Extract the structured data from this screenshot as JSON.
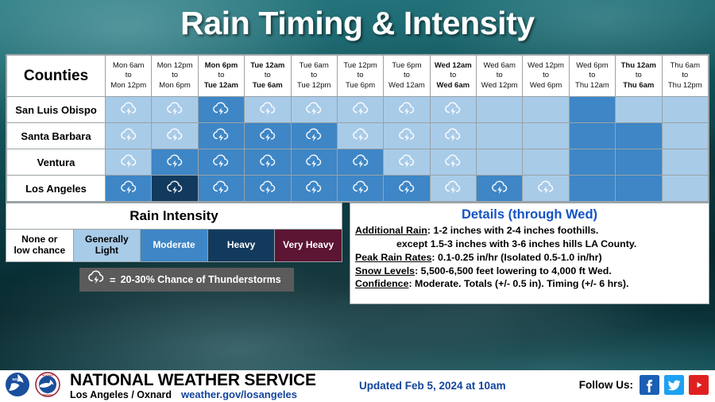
{
  "title": "Rain Timing & Intensity",
  "table": {
    "counties_header": "Counties",
    "periods": [
      {
        "l1": "Mon 6am",
        "l2": "to",
        "l3": "Mon 12pm",
        "bold_l1": false,
        "bold_l3": false
      },
      {
        "l1": "Mon 12pm",
        "l2": "to",
        "l3": "Mon 6pm",
        "bold_l1": false,
        "bold_l3": false
      },
      {
        "l1": "Mon 6pm",
        "l2": "to",
        "l3": "Tue 12am",
        "bold_l1": true,
        "bold_l3": true
      },
      {
        "l1": "Tue 12am",
        "l2": "to",
        "l3": "Tue 6am",
        "bold_l1": true,
        "bold_l3": true
      },
      {
        "l1": "Tue 6am",
        "l2": "to",
        "l3": "Tue 12pm",
        "bold_l1": false,
        "bold_l3": false
      },
      {
        "l1": "Tue 12pm",
        "l2": "to",
        "l3": "Tue 6pm",
        "bold_l1": false,
        "bold_l3": false
      },
      {
        "l1": "Tue 6pm",
        "l2": "to",
        "l3": "Wed 12am",
        "bold_l1": false,
        "bold_l3": false
      },
      {
        "l1": "Wed 12am",
        "l2": "to",
        "l3": "Wed 6am",
        "bold_l1": true,
        "bold_l3": true
      },
      {
        "l1": "Wed 6am",
        "l2": "to",
        "l3": "Wed 12pm",
        "bold_l1": false,
        "bold_l3": false
      },
      {
        "l1": "Wed 12pm",
        "l2": "to",
        "l3": "Wed 6pm",
        "bold_l1": false,
        "bold_l3": false
      },
      {
        "l1": "Wed 6pm",
        "l2": "to",
        "l3": "Thu 12am",
        "bold_l1": false,
        "bold_l3": false
      },
      {
        "l1": "Thu 12am",
        "l2": "to",
        "l3": "Thu 6am",
        "bold_l1": true,
        "bold_l3": true
      },
      {
        "l1": "Thu 6am",
        "l2": "to",
        "l3": "Thu 12pm",
        "bold_l1": false,
        "bold_l3": false
      }
    ],
    "rows": [
      {
        "county": "San Luis Obispo",
        "cells": [
          {
            "intensity": "light",
            "thunder": true
          },
          {
            "intensity": "light",
            "thunder": true
          },
          {
            "intensity": "mod",
            "thunder": true
          },
          {
            "intensity": "light",
            "thunder": true
          },
          {
            "intensity": "light",
            "thunder": true
          },
          {
            "intensity": "light",
            "thunder": true
          },
          {
            "intensity": "light",
            "thunder": true
          },
          {
            "intensity": "light",
            "thunder": true
          },
          {
            "intensity": "light",
            "thunder": false
          },
          {
            "intensity": "light",
            "thunder": false
          },
          {
            "intensity": "mod",
            "thunder": false
          },
          {
            "intensity": "light",
            "thunder": false
          },
          {
            "intensity": "light",
            "thunder": false
          }
        ]
      },
      {
        "county": "Santa Barbara",
        "cells": [
          {
            "intensity": "light",
            "thunder": true
          },
          {
            "intensity": "light",
            "thunder": true
          },
          {
            "intensity": "mod",
            "thunder": true
          },
          {
            "intensity": "mod",
            "thunder": true
          },
          {
            "intensity": "mod",
            "thunder": true
          },
          {
            "intensity": "light",
            "thunder": true
          },
          {
            "intensity": "light",
            "thunder": true
          },
          {
            "intensity": "light",
            "thunder": true
          },
          {
            "intensity": "light",
            "thunder": false
          },
          {
            "intensity": "light",
            "thunder": false
          },
          {
            "intensity": "mod",
            "thunder": false
          },
          {
            "intensity": "mod",
            "thunder": false
          },
          {
            "intensity": "light",
            "thunder": false
          }
        ]
      },
      {
        "county": "Ventura",
        "cells": [
          {
            "intensity": "light",
            "thunder": true
          },
          {
            "intensity": "mod",
            "thunder": true
          },
          {
            "intensity": "mod",
            "thunder": true
          },
          {
            "intensity": "mod",
            "thunder": true
          },
          {
            "intensity": "mod",
            "thunder": true
          },
          {
            "intensity": "mod",
            "thunder": true
          },
          {
            "intensity": "light",
            "thunder": true
          },
          {
            "intensity": "light",
            "thunder": true
          },
          {
            "intensity": "light",
            "thunder": false
          },
          {
            "intensity": "light",
            "thunder": false
          },
          {
            "intensity": "mod",
            "thunder": false
          },
          {
            "intensity": "mod",
            "thunder": false
          },
          {
            "intensity": "light",
            "thunder": false
          }
        ]
      },
      {
        "county": "Los Angeles",
        "cells": [
          {
            "intensity": "mod",
            "thunder": true
          },
          {
            "intensity": "heavy",
            "thunder": true
          },
          {
            "intensity": "mod",
            "thunder": true
          },
          {
            "intensity": "mod",
            "thunder": true
          },
          {
            "intensity": "mod",
            "thunder": true
          },
          {
            "intensity": "mod",
            "thunder": true
          },
          {
            "intensity": "mod",
            "thunder": true
          },
          {
            "intensity": "light",
            "thunder": true
          },
          {
            "intensity": "mod",
            "thunder": true
          },
          {
            "intensity": "light",
            "thunder": true
          },
          {
            "intensity": "mod",
            "thunder": false
          },
          {
            "intensity": "mod",
            "thunder": false
          },
          {
            "intensity": "light",
            "thunder": false
          }
        ]
      }
    ]
  },
  "legend": {
    "title": "Rain Intensity",
    "items": [
      {
        "label": "None or\nlow chance",
        "key": "none",
        "color": "#ffffff",
        "text": "dark"
      },
      {
        "label": "Generally\nLight",
        "key": "light",
        "color": "#a8cbe8",
        "text": "dark"
      },
      {
        "label": "Moderate",
        "key": "mod",
        "color": "#3e86c6",
        "text": "light"
      },
      {
        "label": "Heavy",
        "key": "heavy",
        "color": "#123a5e",
        "text": "light"
      },
      {
        "label": "Very Heavy",
        "key": "vheavy",
        "color": "#5c1533",
        "text": "light"
      }
    ],
    "thunder_note_eq": "=",
    "thunder_note": "20-30% Chance of Thunderstorms"
  },
  "details": {
    "heading": "Details (through Wed)",
    "lines": [
      {
        "label": "Additional Rain",
        "text": ": 1-2 inches with 2-4 inches foothills.",
        "indent": false
      },
      {
        "label": "",
        "text": "except 1.5-3 inches with 3-6 inches hills LA County.",
        "indent": true
      },
      {
        "label": "Peak Rain Rates",
        "text": ": 0.1-0.25 in/hr (Isolated 0.5-1.0 in/hr)",
        "indent": false
      },
      {
        "label": "Snow Levels",
        "text": ": 5,500-6,500 feet lowering to 4,000 ft Wed.",
        "indent": false
      },
      {
        "label": "Confidence",
        "text": ": Moderate. Totals (+/- 0.5 in). Timing (+/- 6 hrs).",
        "indent": false
      }
    ]
  },
  "footer": {
    "agency": "NATIONAL WEATHER SERVICE",
    "office": "Los Angeles / Oxnard",
    "url": "weather.gov/losangeles",
    "updated": "Updated Feb 5, 2024 at 10am",
    "follow_label": "Follow Us:",
    "social": [
      "facebook-icon",
      "twitter-icon",
      "youtube-icon"
    ]
  },
  "colors": {
    "accent_blue": "#12449e",
    "details_heading": "#1353c4",
    "moderate": "#3e86c6",
    "light": "#a8cbe8",
    "heavy": "#123a5e",
    "very_heavy": "#5c1533"
  }
}
